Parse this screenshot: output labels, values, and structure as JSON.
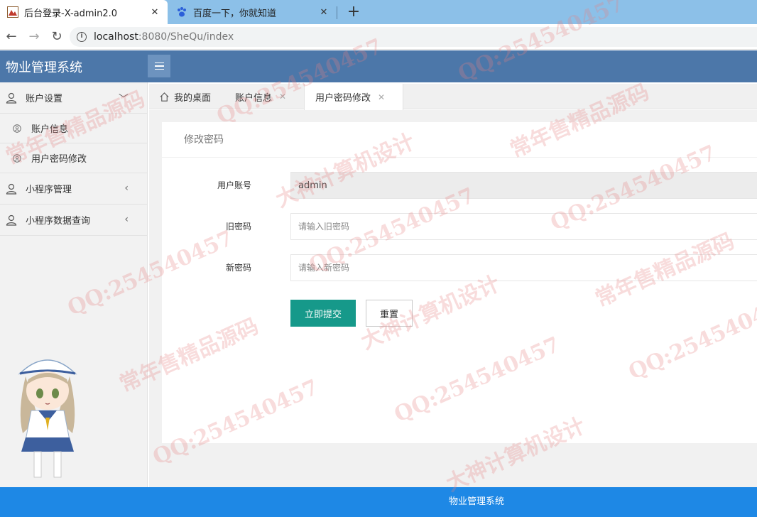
{
  "browser": {
    "tabs": [
      {
        "title": "后台登录-X-admin2.0",
        "close": "✕"
      },
      {
        "title": "百度一下，你就知道",
        "close": "✕"
      }
    ],
    "new_tab": "+",
    "url_host": "localhost",
    "url_rest": ":8080/SheQu/index"
  },
  "app": {
    "title": "物业管理系统"
  },
  "sidebar": {
    "items": [
      {
        "label": "账户设置",
        "caret": "﹀"
      },
      {
        "label": "账户信息"
      },
      {
        "label": "用户密码修改"
      },
      {
        "label": "小程序管理",
        "caret": "‹"
      },
      {
        "label": "小程序数据查询",
        "caret": "‹"
      }
    ]
  },
  "tabs": [
    {
      "label": "我的桌面"
    },
    {
      "label": "账户信息",
      "close": "✕"
    },
    {
      "label": "用户密码修改",
      "close": "✕"
    }
  ],
  "form": {
    "title": "修改密码",
    "account_label": "用户账号",
    "account_value": "admin",
    "old_label": "旧密码",
    "old_placeholder": "请输入旧密码",
    "new_label": "新密码",
    "new_placeholder": "请输入新密码",
    "submit_label": "立即提交",
    "reset_label": "重置"
  },
  "footer": {
    "text": "物业管理系统"
  },
  "watermarks": [
    "QQ:254540457",
    "常年售精品源码",
    "大神计算机设计"
  ]
}
